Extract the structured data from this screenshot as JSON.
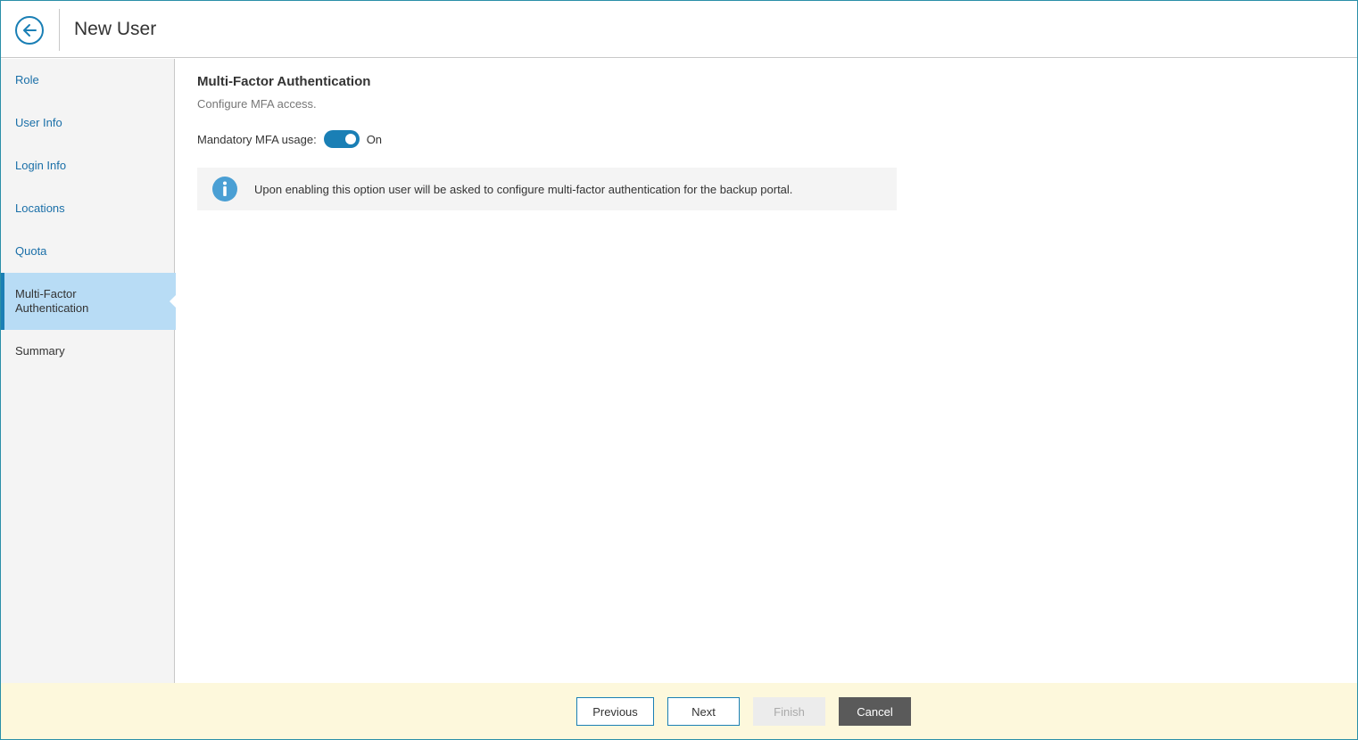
{
  "header": {
    "title": "New User",
    "back_icon": "arrow-left-icon"
  },
  "sidebar": {
    "items": [
      {
        "label": "Role",
        "state": "link"
      },
      {
        "label": "User Info",
        "state": "link"
      },
      {
        "label": "Login Info",
        "state": "link"
      },
      {
        "label": "Locations",
        "state": "link"
      },
      {
        "label": "Quota",
        "state": "link"
      },
      {
        "label": "Multi-Factor\nAuthentication",
        "state": "active"
      },
      {
        "label": "Summary",
        "state": "inactive"
      }
    ]
  },
  "main": {
    "section_title": "Multi-Factor Authentication",
    "section_subtitle": "Configure MFA access.",
    "mfa_label": "Mandatory MFA usage:",
    "mfa_state": "On",
    "mfa_enabled": true,
    "info_icon": "info-icon",
    "info_text": "Upon enabling this option user will be asked to configure multi-factor authentication for the backup portal."
  },
  "footer": {
    "previous_label": "Previous",
    "next_label": "Next",
    "finish_label": "Finish",
    "cancel_label": "Cancel"
  },
  "colors": {
    "accent": "#1a7fb5",
    "active_nav_bg": "#b8dcf5",
    "footer_bg": "#fdf8dc",
    "info_icon": "#4a9fd4"
  }
}
